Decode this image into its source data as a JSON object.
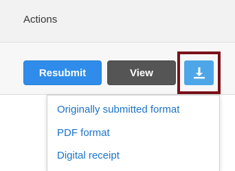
{
  "header": {
    "label": "Actions"
  },
  "buttons": {
    "resubmit_label": "Resubmit",
    "view_label": "View",
    "download_icon": "download-icon"
  },
  "dropdown": {
    "items": [
      {
        "label": "Originally submitted format"
      },
      {
        "label": "PDF format"
      },
      {
        "label": "Digital receipt"
      }
    ]
  },
  "colors": {
    "resubmit_bg": "#2f8cea",
    "view_bg": "#555555",
    "download_bg": "#4da6e8",
    "highlight_border": "#7a1218",
    "link_color": "#1a73c9"
  }
}
